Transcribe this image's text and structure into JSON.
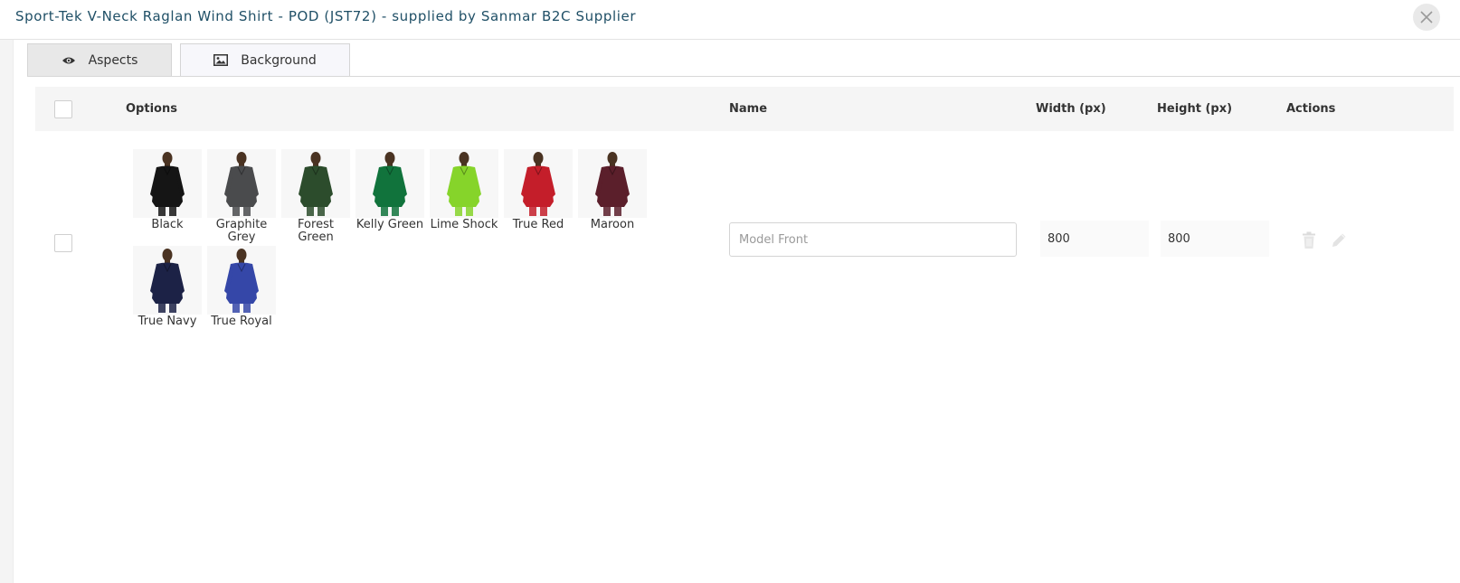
{
  "header": {
    "title": "Sport-Tek V-Neck Raglan Wind Shirt - POD (JST72) - supplied by Sanmar B2C Supplier"
  },
  "tabs": [
    {
      "label": "Aspects",
      "icon": "eye-icon"
    },
    {
      "label": "Background",
      "icon": "image-icon"
    }
  ],
  "table": {
    "headers": {
      "options": "Options",
      "name": "Name",
      "width": "Width (px)",
      "height": "Height (px)",
      "actions": "Actions"
    },
    "row": {
      "name_placeholder": "Model Front",
      "width": "800",
      "height": "800",
      "options": [
        {
          "label": "Black",
          "color": "#151515"
        },
        {
          "label": "Graphite Grey",
          "color": "#4a4b4d"
        },
        {
          "label": "Forest Green",
          "color": "#2c4c2c"
        },
        {
          "label": "Kelly Green",
          "color": "#11733c"
        },
        {
          "label": "Lime Shock",
          "color": "#86d42a"
        },
        {
          "label": "True Red",
          "color": "#c41e2a"
        },
        {
          "label": "Maroon",
          "color": "#5b1f2b"
        },
        {
          "label": "True Navy",
          "color": "#1c2246"
        },
        {
          "label": "True Royal",
          "color": "#3547a8"
        }
      ]
    }
  },
  "colors": {
    "title": "#1f4f66",
    "table_header_bg": "#f5f5f5",
    "icon_muted": "#d8d8d8"
  }
}
